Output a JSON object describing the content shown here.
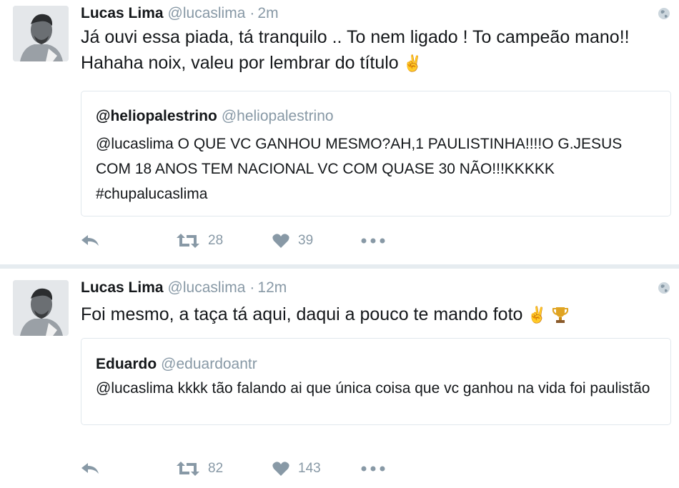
{
  "tweets": [
    {
      "author": {
        "name": "Lucas Lima",
        "handle": "@lucaslima"
      },
      "time": "2m",
      "text": "Já ouvi essa piada, tá tranquilo .. To nem ligado ! To campeão mano!! Hahaha noix, valeu por lembrar do título",
      "emojis": [
        "✌"
      ],
      "quoted": {
        "name": "@heliopalestrino",
        "handle": "@heliopalestrino",
        "text": "@lucaslima O QUE VC GANHOU MESMO?AH,1 PAULISTINHA!!!!O G.JESUS COM 18 ANOS TEM NACIONAL VC COM QUASE 30 NÃO!!!KKKKK #chupalucaslima"
      },
      "retweets": "28",
      "likes": "39"
    },
    {
      "author": {
        "name": "Lucas Lima",
        "handle": "@lucaslima"
      },
      "time": "12m",
      "text": "Foi mesmo, a taça tá aqui, daqui a pouco te mando foto",
      "emojis": [
        "✌",
        "🏆"
      ],
      "quoted": {
        "name": "Eduardo",
        "handle": "@eduardoantr",
        "text": "@lucaslima kkkk tão falando ai que única coisa que vc ganhou na vida foi paulistão"
      },
      "retweets": "82",
      "likes": "143"
    }
  ],
  "icons": {
    "reply": "reply-icon",
    "retweet": "retweet-icon",
    "like": "heart-icon",
    "more": "more-icon",
    "globe": "globe-icon"
  },
  "colors": {
    "text": "#14171a",
    "muted": "#8899a6",
    "border": "#e1e8ed",
    "separator": "#e6ecf0"
  },
  "separator": "·"
}
